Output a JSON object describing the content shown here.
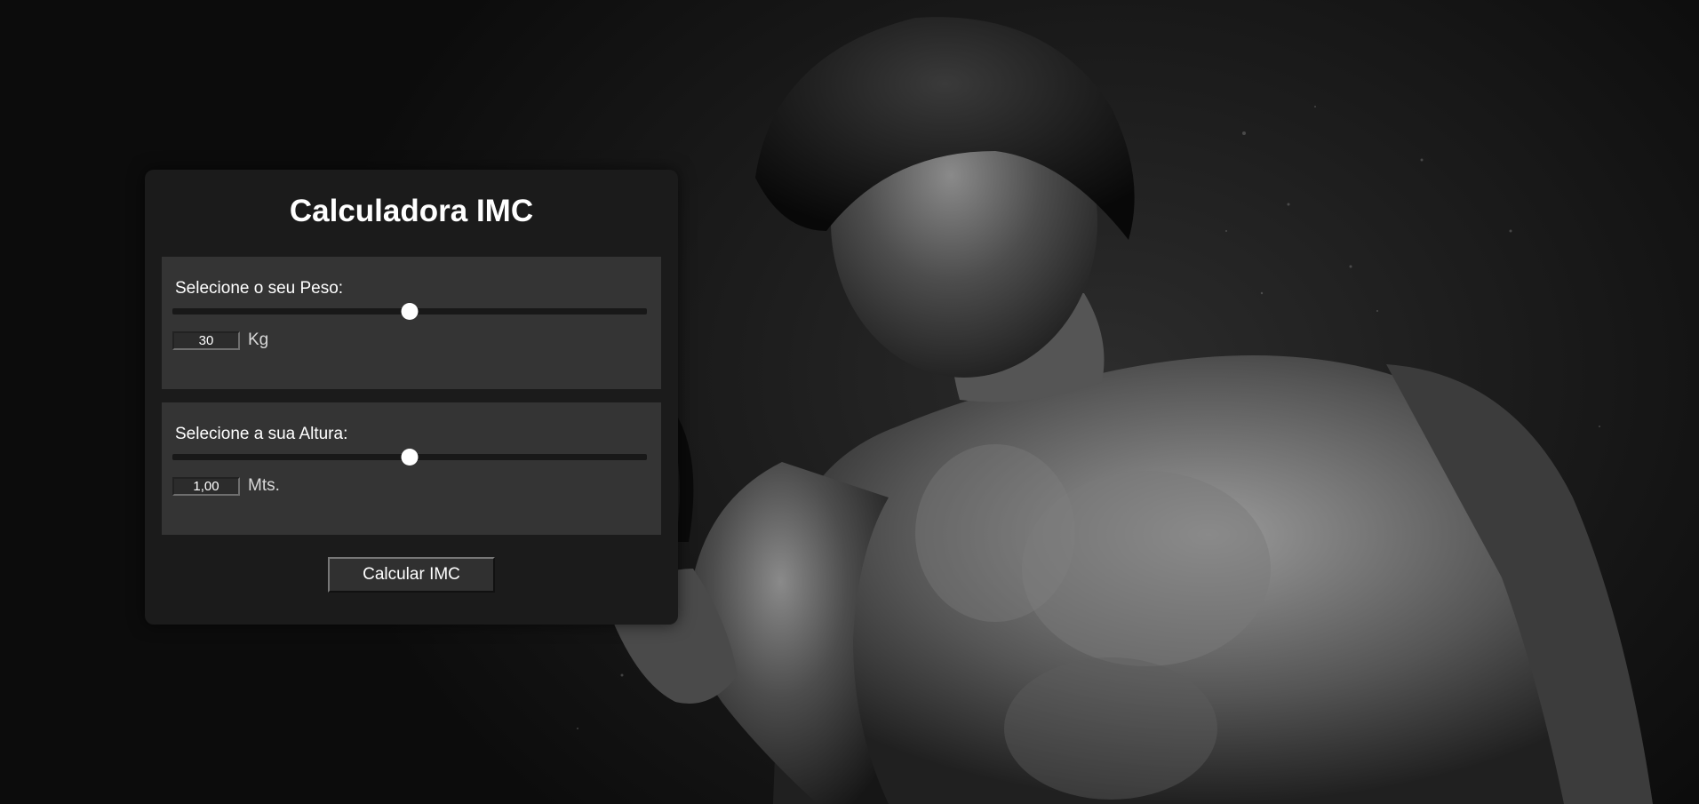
{
  "page": {
    "background_image": "bodybuilder-flexing-biceps-black-and-white"
  },
  "calculator": {
    "title": "Calculadora IMC",
    "peso": {
      "label": "Selecione o seu Peso:",
      "value": "30",
      "unit": "Kg",
      "slider_fraction": 0.5
    },
    "altura": {
      "label": "Selecione a sua Altura:",
      "value": "1,00",
      "unit": "Mts.",
      "slider_fraction": 0.5
    },
    "button_label": "Calcular IMC"
  },
  "colors": {
    "card_bg": "#1b1b1b",
    "panel_bg": "#343434",
    "text": "#ffffff"
  }
}
